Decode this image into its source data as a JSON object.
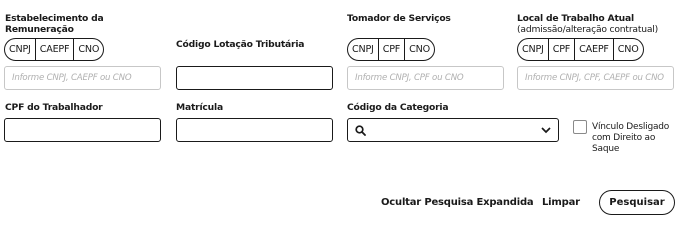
{
  "sections": {
    "estabelecimento": {
      "label": "Estabelecimento da Remuneração",
      "options": [
        "CNPJ",
        "CAEPF",
        "CNO"
      ],
      "placeholder": "Informe CNPJ, CAEPF ou CNO"
    },
    "lotacao": {
      "label": "Código Lotação Tributária",
      "value": ""
    },
    "tomador": {
      "label": "Tomador de Serviços",
      "options": [
        "CNPJ",
        "CPF",
        "CNO"
      ],
      "placeholder": "Informe CNPJ, CPF ou CNO"
    },
    "local_trabalho": {
      "label_line1": "Local de Trabalho Atual",
      "label_line2": "(admissão/alteração contratual)",
      "options": [
        "CNPJ",
        "CPF",
        "CAEPF",
        "CNO"
      ],
      "placeholder": "Informe CNPJ, CPF, CAEPF ou CNO"
    },
    "cpf_trabalhador": {
      "label": "CPF do Trabalhador",
      "value": ""
    },
    "matricula": {
      "label": "Matrícula",
      "value": ""
    },
    "categoria": {
      "label": "Código da Categoria",
      "value": "",
      "icon": "search-icon"
    },
    "vinculo": {
      "label": "Vínculo Desligado com Direito ao Saque",
      "checked": false
    }
  },
  "actions": {
    "ocultar": "Ocultar Pesquisa Expandida",
    "limpar": "Limpar",
    "pesquisar": "Pesquisar"
  }
}
